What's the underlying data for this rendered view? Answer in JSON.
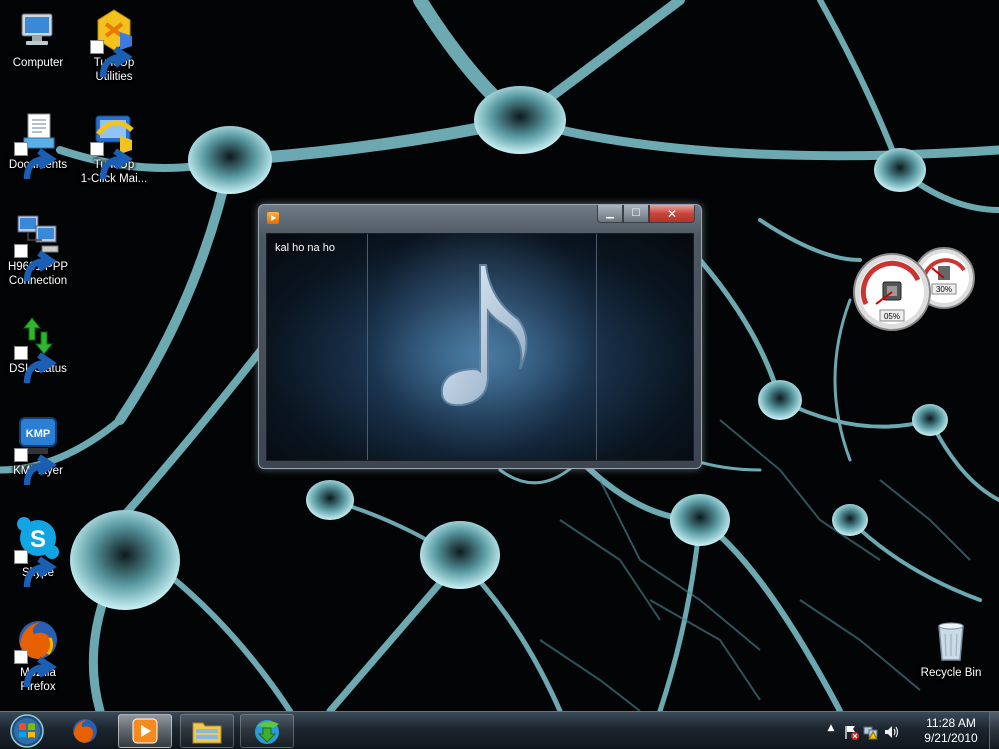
{
  "desktop": {
    "icons": [
      {
        "label": "Computer"
      },
      {
        "label": "TuneUp\nUtilities"
      },
      {
        "label": "Documents"
      },
      {
        "label": "TuneUp\n1-Click Mai..."
      },
      {
        "label": "H9601 PPP\nConnection"
      },
      {
        "label": "DSL Status"
      },
      {
        "label": "KMPlayer"
      },
      {
        "label": "Skype"
      },
      {
        "label": "Mozilla\nFirefox"
      },
      {
        "label": "Recycle Bin"
      }
    ],
    "kmp_logo_text": "KMP"
  },
  "media_window": {
    "track_title": "kal ho na ho",
    "min_glyph": "▁",
    "max_glyph": "☐",
    "close_glyph": "✕"
  },
  "gadget": {
    "cpu_percent": "05%",
    "memory_percent": "30%"
  },
  "taskbar": {
    "clock_time": "11:28 AM",
    "clock_date": "9/21/2010",
    "tray_arrow": "▲"
  },
  "colors": {
    "taskbar": "#1c2630",
    "wallpaper_neuron": "#8fd6e0",
    "window_frame": "#4e5863"
  }
}
